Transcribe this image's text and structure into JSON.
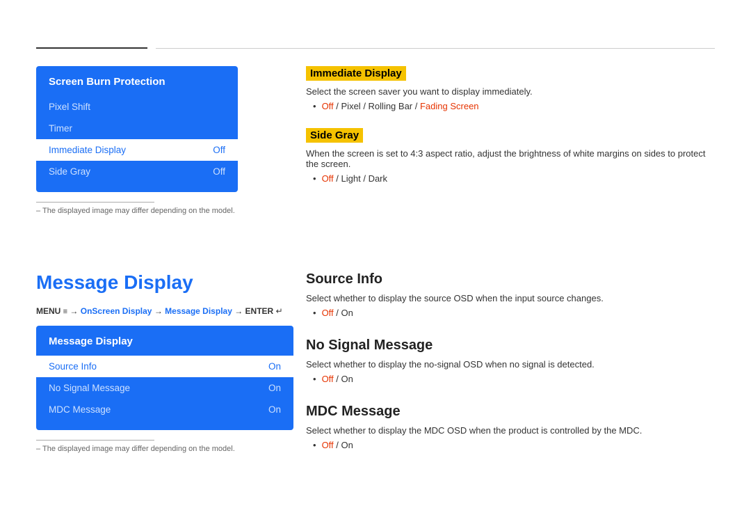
{
  "top": {
    "divider_note": ""
  },
  "screen_burn": {
    "title": "Screen Burn Protection",
    "items": [
      {
        "label": "Pixel Shift",
        "value": "",
        "selected": false
      },
      {
        "label": "Timer",
        "value": "",
        "selected": false
      },
      {
        "label": "Immediate Display",
        "value": "Off",
        "selected": true
      },
      {
        "label": "Side Gray",
        "value": "Off",
        "selected": false
      }
    ],
    "note": "The displayed image may differ depending on the model."
  },
  "immediate_display": {
    "title": "Immediate Display",
    "desc": "Select the screen saver you want to display immediately.",
    "bullet": "Off / Pixel / Rolling Bar / Fading Screen",
    "bullet_parts": {
      "off": "Off",
      "sep1": " / ",
      "pixel": "Pixel",
      "sep2": " / ",
      "rolling": "Rolling Bar",
      "sep3": " / ",
      "fading": "Fading Screen"
    }
  },
  "side_gray": {
    "title": "Side Gray",
    "desc": "When the screen is set to 4:3 aspect ratio, adjust the brightness of white margins on sides to protect the screen.",
    "bullet_parts": {
      "off": "Off",
      "sep1": " / ",
      "light": "Light",
      "sep2": " / ",
      "dark": "Dark"
    }
  },
  "message_display_section": {
    "title": "Message Display",
    "menu_path_parts": {
      "menu": "MENU",
      "menu_icon": "≡",
      "arrow1": "→",
      "onscreen": "OnScreen Display",
      "arrow2": "→",
      "message": "Message Display",
      "arrow3": "→",
      "enter": "ENTER",
      "enter_icon": "↵"
    }
  },
  "message_display_menu": {
    "title": "Message Display",
    "items": [
      {
        "label": "Source Info",
        "value": "On",
        "selected": true
      },
      {
        "label": "No Signal Message",
        "value": "On",
        "selected": false
      },
      {
        "label": "MDC Message",
        "value": "On",
        "selected": false
      }
    ],
    "note": "The displayed image may differ depending on the model."
  },
  "source_info": {
    "title": "Source Info",
    "desc": "Select whether to display the source OSD when the input source changes.",
    "off_label": "Off",
    "sep": " / ",
    "on_label": "On"
  },
  "no_signal_message": {
    "title": "No Signal Message",
    "desc": "Select whether to display the no-signal OSD when no signal is detected.",
    "off_label": "Off",
    "sep": " / ",
    "on_label": "On"
  },
  "mdc_message": {
    "title": "MDC Message",
    "desc": "Select whether to display the MDC OSD when the product is controlled by the MDC.",
    "off_label": "Off",
    "sep": " / ",
    "on_label": "On"
  }
}
